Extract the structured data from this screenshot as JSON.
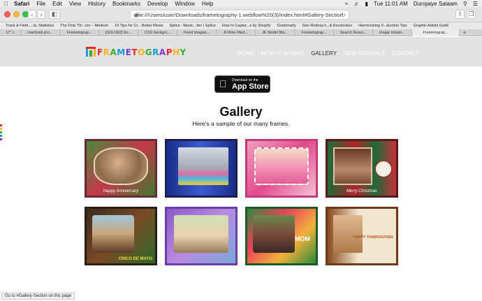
{
  "menubar": {
    "app": "Safari",
    "items": [
      "File",
      "Edit",
      "View",
      "History",
      "Bookmarks",
      "Develop",
      "Window",
      "Help"
    ],
    "clock": "Tue 11:01 AM",
    "user": "Durojaiye Salaam"
  },
  "toolbar": {
    "url": "file:///Users/user/Downloads/frametography-1.webflow%20(3)/index.html#Gallery-Section"
  },
  "bookmarks": [
    "Track & Field, ...ts, Statistics",
    "The Only Thi...ion – Medium",
    "10 Tips for Cr... Better Mixes",
    "Splice - Music...tter | Splice",
    "How to Captur...e by Shopify",
    "Grammarly",
    "Dan Rodney's...& Keystrokes",
    "Harmonizing V...duction Tips",
    "Graphic Artists Guild"
  ],
  "tabs": [
    "17\" c",
    "macbook pro...",
    "Frametograp...",
    "[SOLVED] Ex...",
    "CSS backgro...",
    "Fixed images...",
    "A More Mod...",
    "JE Model Ma...",
    "Frametograp...",
    "Search Resul...",
    "image missin...",
    "Frametograp..."
  ],
  "site": {
    "logo": "FRAMETOGRAPHY",
    "nav": [
      "HOME",
      "HOW IT WORKS",
      "GALLERY",
      "NEW ARRIVALS",
      "CONTACT"
    ],
    "active_nav": "GALLERY"
  },
  "appstore": {
    "small": "Download on the",
    "big": "App Store"
  },
  "gallery": {
    "title": "Gallery",
    "subtitle": "Here's a sample of our many frames.",
    "frames": [
      {
        "theme": "anniversary",
        "caption": "Happy Anniversary"
      },
      {
        "theme": "birthday",
        "caption": ""
      },
      {
        "theme": "pink-party",
        "caption": ""
      },
      {
        "theme": "christmas",
        "caption": "Merry Christmas"
      },
      {
        "theme": "cinco-de-mayo",
        "caption": "CINCO DE MAYO"
      },
      {
        "theme": "spring",
        "caption": ""
      },
      {
        "theme": "mom",
        "caption": "MOM"
      },
      {
        "theme": "thanksgiving",
        "caption": "HAPPY THANKSGIVING"
      }
    ]
  },
  "status": "Go to #Gallery-Section on this page"
}
